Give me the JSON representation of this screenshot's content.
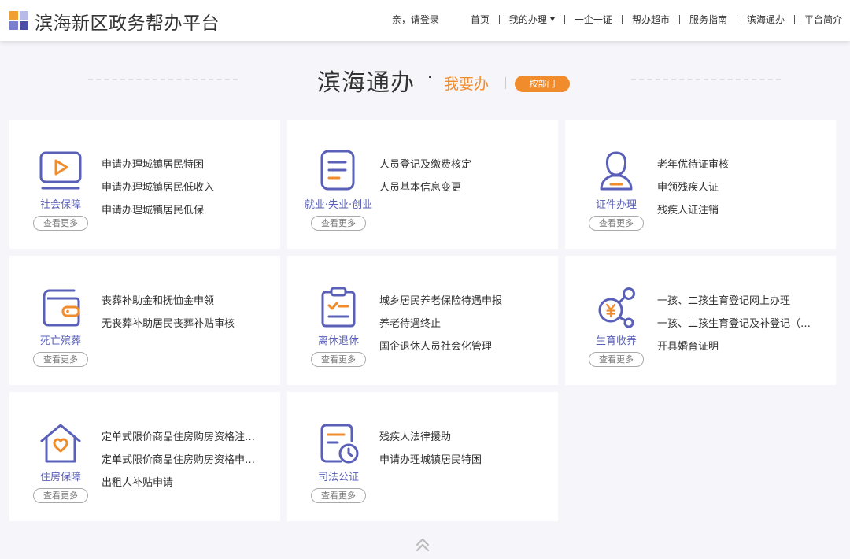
{
  "header": {
    "title": "滨海新区政务帮办平台",
    "login": "亲，请登录",
    "nav": [
      "首页",
      "我的办理",
      "一企一证",
      "帮办超市",
      "服务指南",
      "滨海通办",
      "平台简介"
    ],
    "logo_colors": [
      "#f0a030",
      "#7b7fd0",
      "#4a4fa8",
      "#f08c2c"
    ]
  },
  "heading": {
    "main": "滨海通办",
    "dot": "·",
    "sub": "我要办",
    "button": "按部门"
  },
  "cards": [
    {
      "category": "社会保障",
      "icon": "monitor-play-icon",
      "more": "查看更多",
      "items": [
        "申请办理城镇居民特困",
        "申请办理城镇居民低收入",
        "申请办理城镇居民低保"
      ]
    },
    {
      "category": "就业·失业·创业",
      "icon": "document-list-icon",
      "more": "查看更多",
      "items": [
        "人员登记及缴费核定",
        "人员基本信息变更"
      ]
    },
    {
      "category": "证件办理",
      "icon": "person-badge-icon",
      "more": "查看更多",
      "items": [
        "老年优待证审核",
        "申领残疾人证",
        "残疾人证注销"
      ]
    },
    {
      "category": "死亡殡葬",
      "icon": "wallet-icon",
      "more": "查看更多",
      "items": [
        "丧葬补助金和抚恤金申领",
        "无丧葬补助居民丧葬补贴审核"
      ]
    },
    {
      "category": "离休退休",
      "icon": "clipboard-check-icon",
      "more": "查看更多",
      "items": [
        "城乡居民养老保险待遇申报",
        "养老待遇终止",
        "国企退休人员社会化管理"
      ]
    },
    {
      "category": "生育收养",
      "icon": "share-yen-icon",
      "more": "查看更多",
      "items": [
        "一孩、二孩生育登记网上办理",
        "一孩、二孩生育登记及补登记（…",
        "开具婚育证明"
      ]
    },
    {
      "category": "住房保障",
      "icon": "house-heart-icon",
      "more": "查看更多",
      "items": [
        "定单式限价商品住房购房资格注…",
        "定单式限价商品住房购房资格申…",
        "出租人补贴申请"
      ]
    },
    {
      "category": "司法公证",
      "icon": "document-clock-icon",
      "more": "查看更多",
      "items": [
        "残疾人法律援助",
        "申请办理城镇居民特困"
      ]
    }
  ],
  "colors": {
    "primary": "#5a60b8",
    "accent": "#f08c2c"
  }
}
